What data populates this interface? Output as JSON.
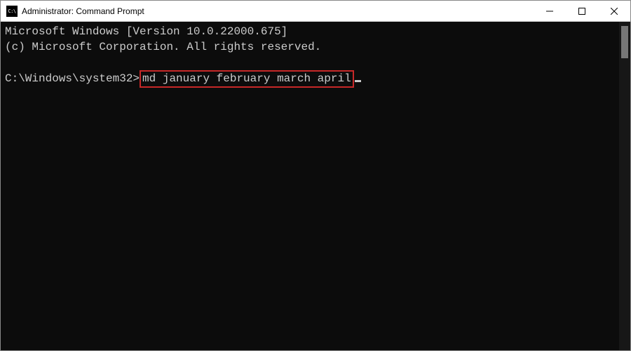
{
  "window": {
    "title": "Administrator: Command Prompt",
    "icon_label": "C:\\"
  },
  "terminal": {
    "line1": "Microsoft Windows [Version 10.0.22000.675]",
    "line2": "(c) Microsoft Corporation. All rights reserved.",
    "prompt": "C:\\Windows\\system32>",
    "command": "md january february march april"
  },
  "colors": {
    "terminal_bg": "#0c0c0c",
    "terminal_fg": "#cccccc",
    "highlight_border": "#c62828"
  }
}
